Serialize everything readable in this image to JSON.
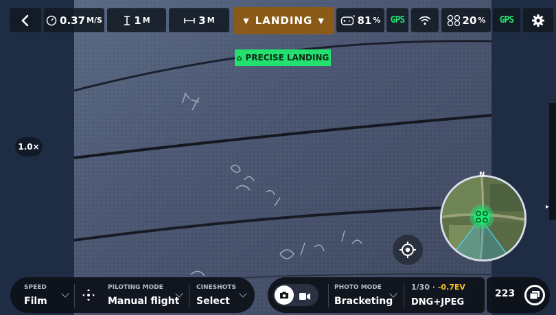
{
  "top_bar": {
    "back_label": "<",
    "speed_value": "0.37",
    "speed_unit": "M/S",
    "altitude_value": "1",
    "altitude_unit": "M",
    "distance_value": "3",
    "distance_unit": "M",
    "flight_state": "LANDING",
    "controller_battery": "81",
    "controller_battery_unit": "%",
    "controller_gps": "GPS",
    "drone_battery": "20",
    "drone_battery_unit": "%",
    "drone_gps": "GPS"
  },
  "overlay": {
    "precise_landing_label": "PRECISE LANDING",
    "zoom_level": "1.0×",
    "minimap_north": "N"
  },
  "bottom_bar": {
    "speed_label": "SPEED",
    "speed_value": "Film",
    "piloting_label": "PILOTING MODE",
    "piloting_value": "Manual flight",
    "cineshots_label": "CINESHOTS",
    "cineshots_value": "Select",
    "photo_mode_label": "PHOTO MODE",
    "photo_mode_value": "Bracketing",
    "shutter": "1/30",
    "separator": "·",
    "exposure": "-0.7EV",
    "format": "DNG+JPEG",
    "photo_count": "223"
  },
  "colors": {
    "landing_bg": "#8a5a19",
    "gps_green": "#1ee36e",
    "exposure_yellow": "#f2c230",
    "precise_green": "#23e06f"
  },
  "icons": [
    "back-icon",
    "speedometer-icon",
    "altitude-icon",
    "distance-icon",
    "controller-icon",
    "wifi-icon",
    "drone-icon",
    "settings-icon",
    "locate-icon",
    "photo-icon",
    "video-icon",
    "gallery-icon"
  ]
}
